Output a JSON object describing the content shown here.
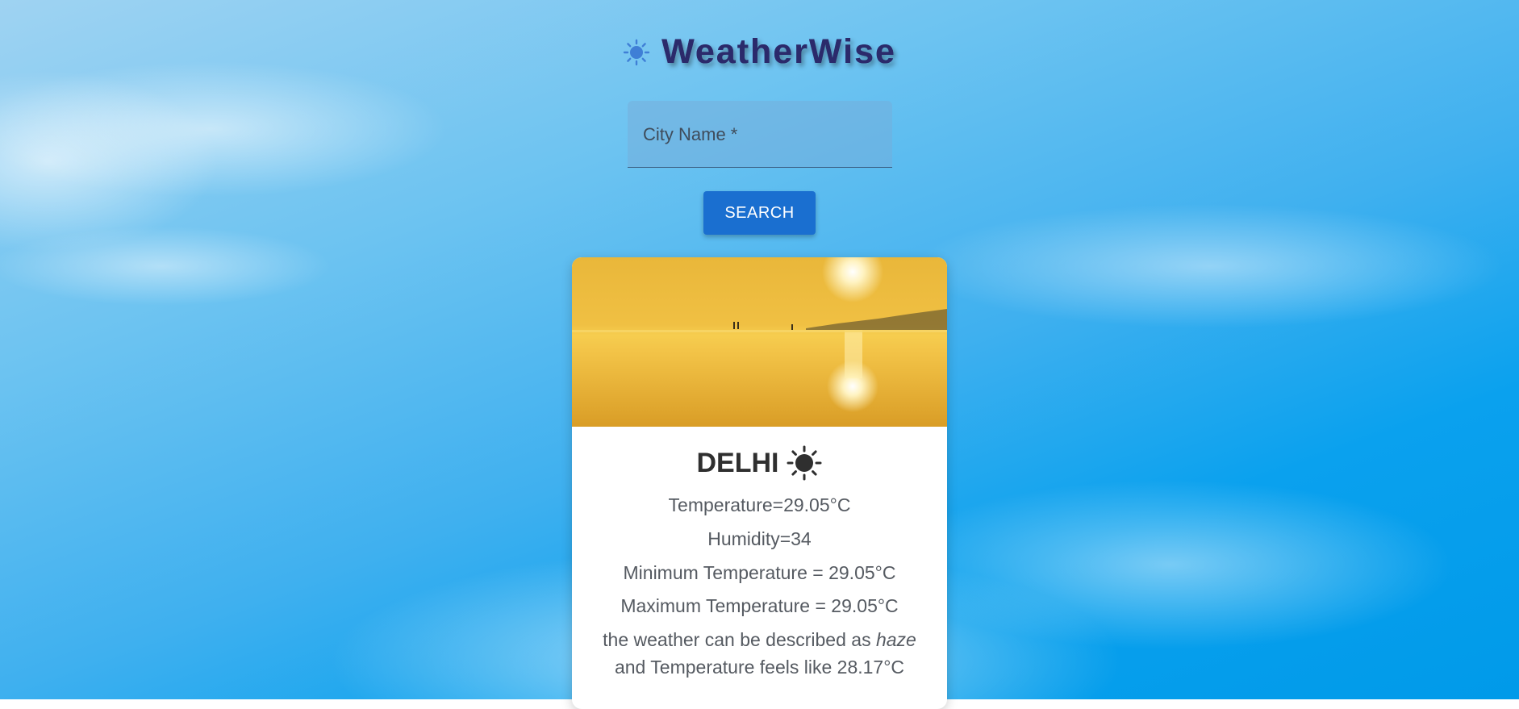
{
  "app": {
    "title": "WeatherWise",
    "logo_icon": "sun-icon"
  },
  "search": {
    "placeholder": "City Name *",
    "value": "",
    "button_label": "SEARCH"
  },
  "card": {
    "image": "sunset-beach-image",
    "city": "DELHI",
    "weather_icon": "sun-icon",
    "temperature": "Temperature=29.05°C",
    "humidity": "Humidity=34",
    "min_temperature": "Minimum Temperature = 29.05°C",
    "max_temperature": "Maximum Temperature = 29.05°C",
    "description_prefix": "the weather can be described as ",
    "description_value": "haze",
    "feels_like": "and Temperature feels like 28.17°C"
  },
  "colors": {
    "button": "#1a6fd0",
    "title": "#2b2a6b",
    "sky": "#0aa1ee"
  }
}
